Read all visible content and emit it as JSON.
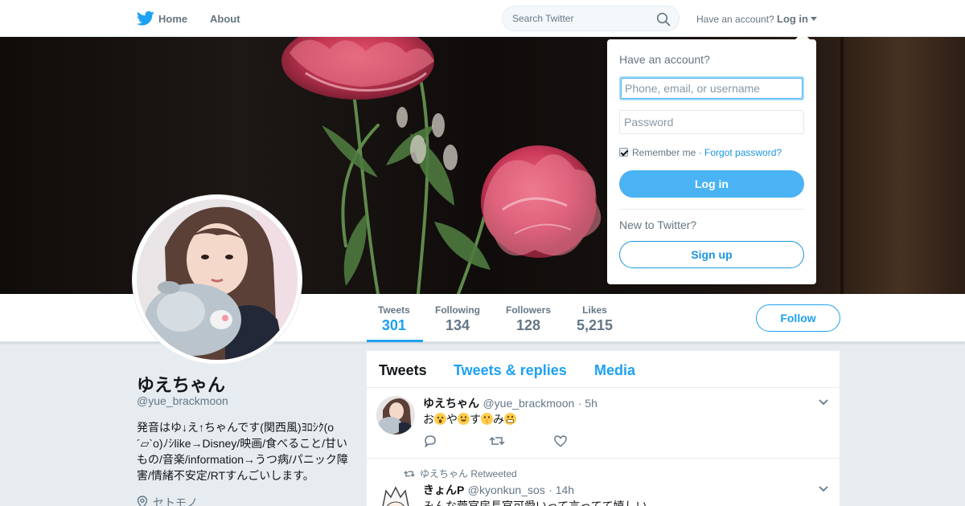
{
  "topnav": {
    "home_label": "Home",
    "about_label": "About",
    "search_placeholder": "Search Twitter",
    "have_account": "Have an account?",
    "login_label": "Log in",
    "icons": [
      "twitter-bird-icon",
      "search-icon",
      "chevron-down-icon"
    ]
  },
  "colors": {
    "accent": "#1da1f2",
    "login_button": "#4ab3f4",
    "muted_text": "#657786",
    "background": "#e6ecf0"
  },
  "profile": {
    "name": "ゆえちゃん",
    "handle": "@yue_brackmoon",
    "bio": "発音はゆ↓え↑ちゃんです(関西風)ﾖﾛｼｸ(o´▱`o)ﾉｼlike→Disney/映画/食べること/甘いもの/音楽/information→うつ病/パニック障害/情緒不安定/RTすんごいします。",
    "location": "セトモノ"
  },
  "stats": [
    {
      "label": "Tweets",
      "value": "301"
    },
    {
      "label": "Following",
      "value": "134"
    },
    {
      "label": "Followers",
      "value": "128"
    },
    {
      "label": "Likes",
      "value": "5,215"
    }
  ],
  "follow_label": "Follow",
  "timeline": {
    "tabs": [
      "Tweets",
      "Tweets & replies",
      "Media"
    ],
    "tweets": [
      {
        "name": "ゆえちゃん",
        "handle": "@yue_brackmoon",
        "time": "· 5h",
        "text_parts": [
          "お",
          "や",
          "す",
          "み"
        ]
      },
      {
        "retweet_context": "ゆえちゃん Retweeted",
        "name": "きょんP",
        "handle": "@kyonkun_sos",
        "time": "· 14h",
        "text": "みんな菅官房長官可愛いって言ってて嬉しい"
      }
    ]
  },
  "login_dropdown": {
    "title": "Have an account?",
    "username_placeholder": "Phone, email, or username",
    "password_placeholder": "Password",
    "remember_label": "Remember me ·",
    "forgot_label": "Forgot password?",
    "remember_checked": true,
    "login_button": "Log in",
    "new_to": "New to Twitter?",
    "signup_button": "Sign up"
  }
}
